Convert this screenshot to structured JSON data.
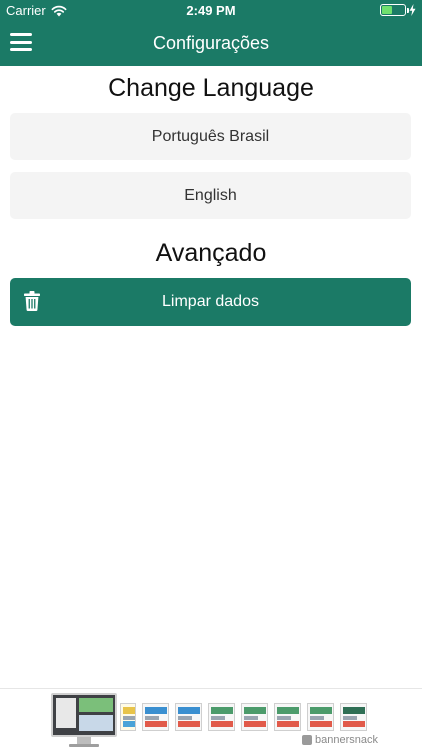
{
  "status_bar": {
    "carrier": "Carrier",
    "time": "2:49 PM",
    "battery_level": 0.45,
    "icons": {
      "wifi": "wifi-icon",
      "battery": "battery-icon",
      "charging": "bolt-icon"
    }
  },
  "nav": {
    "title": "Configurações",
    "menu_icon": "hamburger-menu-icon"
  },
  "language_section": {
    "title": "Change Language",
    "options": [
      "Português Brasil",
      "English"
    ]
  },
  "advanced_section": {
    "title": "Avançado",
    "clear_button": {
      "label": "Limpar dados",
      "icon": "trash-icon"
    }
  },
  "banner": {
    "brand": "bannersnack"
  },
  "colors": {
    "primary": "#1b7a66",
    "button_bg": "#f4f4f4",
    "text": "#111111",
    "battery_fill": "#6fe06f"
  }
}
